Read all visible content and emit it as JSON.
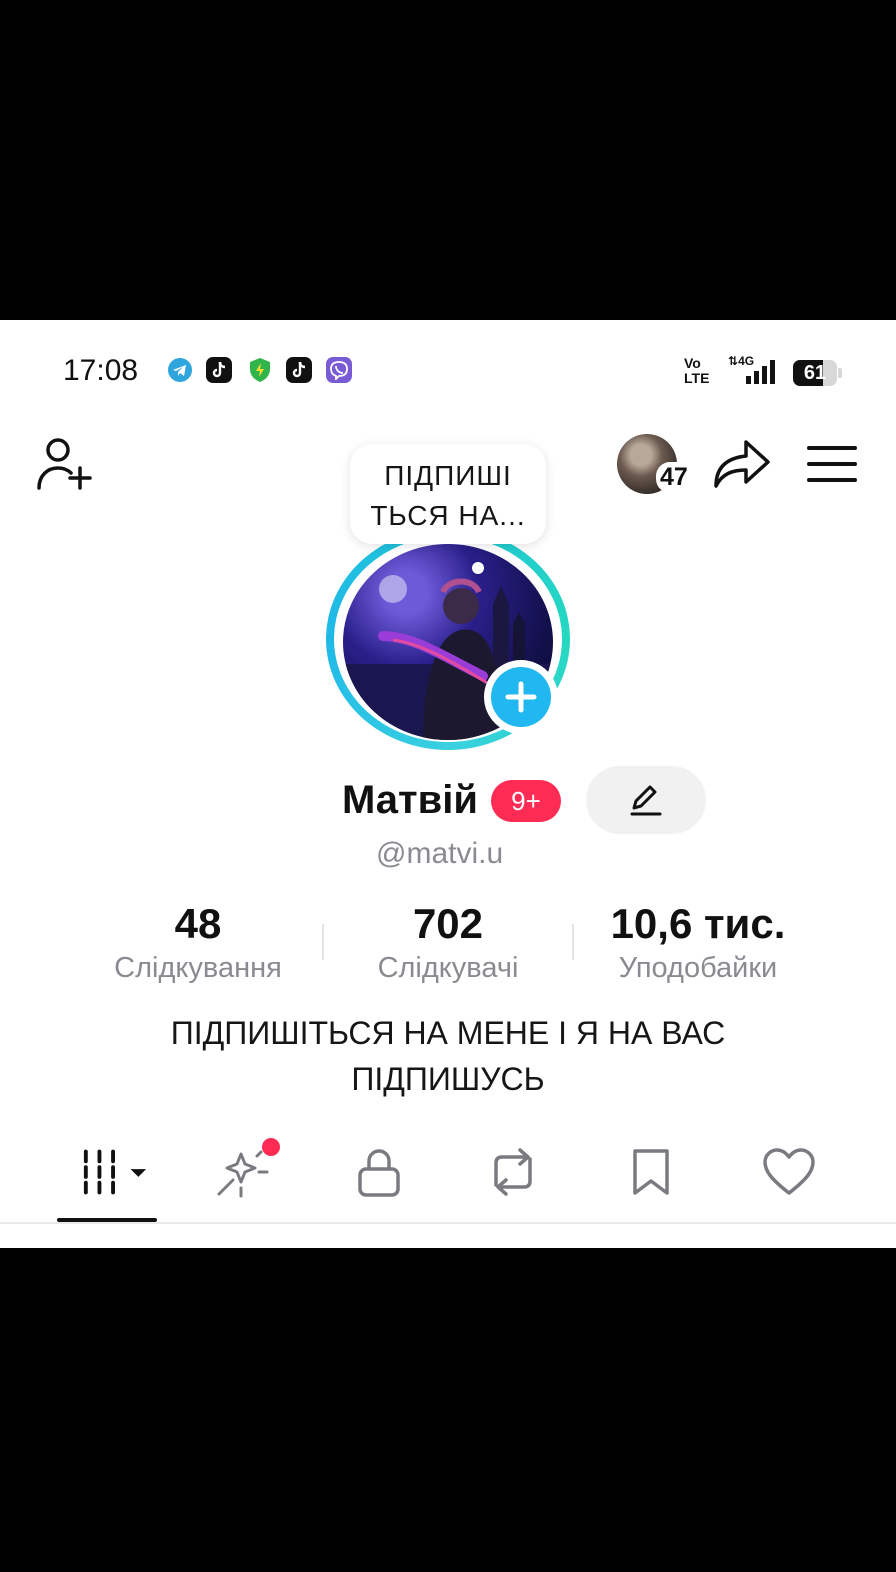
{
  "status_bar": {
    "time": "17:08",
    "network_vo": "Vo",
    "network_lte": "LTE",
    "network_type": "4G",
    "battery": "61"
  },
  "header": {
    "story_count": "47",
    "bubble_line1": "ПІДПИШІ",
    "bubble_line2": "ТЬСЯ НА..."
  },
  "profile": {
    "name": "Матвій",
    "badge": "9+",
    "username": "@matvi.u",
    "bio_line1": "ПІДПИШІТЬСЯ НА МЕНЕ І Я НА ВАС",
    "bio_line2": "ПІДПИШУСЬ"
  },
  "stats": [
    {
      "value": "48",
      "label": "Слідкування"
    },
    {
      "value": "702",
      "label": "Слідкувачі"
    },
    {
      "value": "10,6 тис.",
      "label": "Уподобайки"
    }
  ],
  "tabs": [
    {
      "icon": "videos-grid-icon",
      "active": true
    },
    {
      "icon": "sparkle-icon",
      "active": false,
      "notification_dot": true
    },
    {
      "icon": "lock-icon",
      "active": false
    },
    {
      "icon": "repost-icon",
      "active": false
    },
    {
      "icon": "bookmark-icon",
      "active": false
    },
    {
      "icon": "heart-icon",
      "active": false
    }
  ],
  "colors": {
    "accent": "#fe2c55",
    "plus": "#21b7f0",
    "ring": "#21c6d8",
    "muted": "#8a8b91"
  }
}
